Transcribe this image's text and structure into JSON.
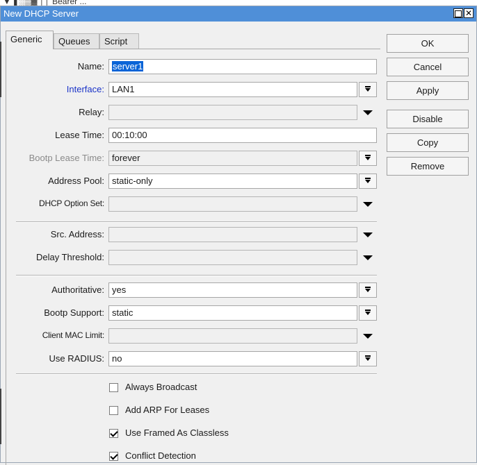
{
  "background_strip": {
    "text": "▼▐ ░▒▓ ││ Bearer ..."
  },
  "window": {
    "title": "New DHCP Server"
  },
  "tabs": [
    {
      "label": "Generic",
      "active": true
    },
    {
      "label": "Queues",
      "active": false
    },
    {
      "label": "Script",
      "active": false
    }
  ],
  "fields": {
    "name": {
      "label": "Name:",
      "value": "server1"
    },
    "interface": {
      "label": "Interface:",
      "value": "LAN1"
    },
    "relay": {
      "label": "Relay:",
      "value": ""
    },
    "lease_time": {
      "label": "Lease Time:",
      "value": "00:10:00"
    },
    "bootp_lease_time": {
      "label": "Bootp Lease Time:",
      "value": "forever"
    },
    "address_pool": {
      "label": "Address Pool:",
      "value": "static-only"
    },
    "dhcp_option_set": {
      "label": "DHCP Option Set:",
      "value": ""
    },
    "src_address": {
      "label": "Src. Address:",
      "value": ""
    },
    "delay_threshold": {
      "label": "Delay Threshold:",
      "value": ""
    },
    "authoritative": {
      "label": "Authoritative:",
      "value": "yes"
    },
    "bootp_support": {
      "label": "Bootp Support:",
      "value": "static"
    },
    "client_mac_limit": {
      "label": "Client MAC Limit:",
      "value": ""
    },
    "use_radius": {
      "label": "Use RADIUS:",
      "value": "no"
    }
  },
  "checkboxes": [
    {
      "label": "Always Broadcast",
      "checked": false
    },
    {
      "label": "Add ARP For Leases",
      "checked": false
    },
    {
      "label": "Use Framed As Classless",
      "checked": true
    },
    {
      "label": "Conflict Detection",
      "checked": true
    }
  ],
  "buttons": {
    "ok": "OK",
    "cancel": "Cancel",
    "apply": "Apply",
    "disable": "Disable",
    "copy": "Copy",
    "remove": "Remove"
  },
  "colors": {
    "titlebar": "#4f8fd8",
    "selection": "#0a64d7",
    "link_label": "#1a33c8",
    "disabled_label": "#8a8a8a"
  }
}
